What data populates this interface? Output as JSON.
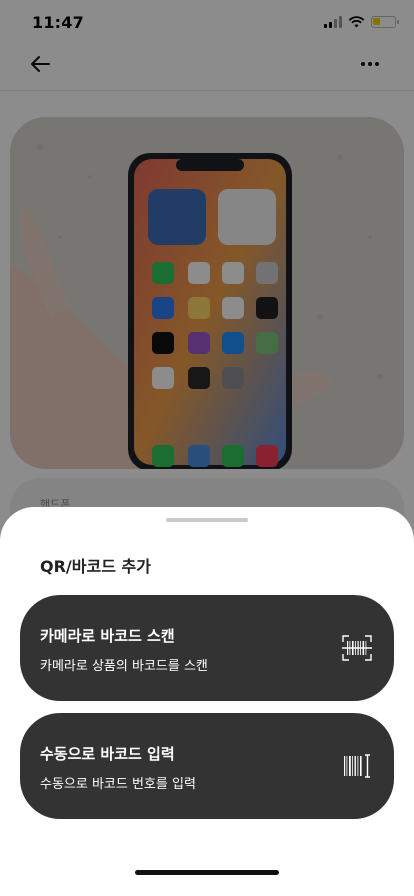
{
  "status_bar": {
    "time": "11:47"
  },
  "background": {
    "card_label": "핸드폰"
  },
  "sheet": {
    "title": "QR/바코드 추가",
    "options": [
      {
        "title": "카메라로 바코드 스캔",
        "description": "카메라로 상품의 바코드를 스캔",
        "icon": "barcode-scan-icon"
      },
      {
        "title": "수동으로 바코드 입력",
        "description": "수동으로 바코드 번호를 입력",
        "icon": "barcode-input-icon"
      }
    ]
  },
  "colors": {
    "option_bg": "#333333",
    "overlay": "#000000",
    "battery": "#f2d600"
  }
}
